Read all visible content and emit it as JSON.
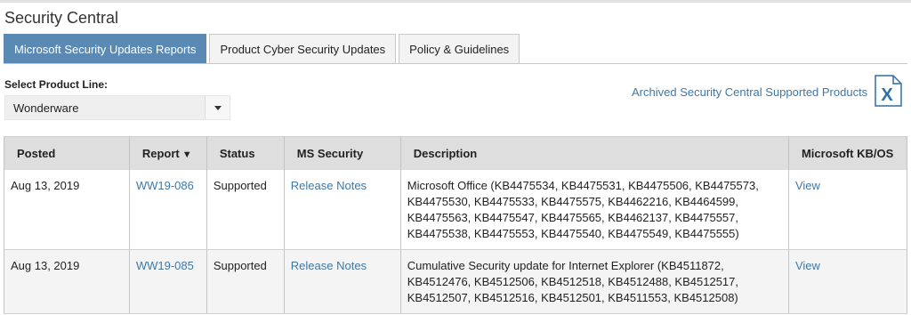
{
  "page": {
    "title": "Security Central"
  },
  "tabs": [
    {
      "label": "Microsoft Security Updates Reports",
      "active": true
    },
    {
      "label": "Product Cyber Security Updates",
      "active": false
    },
    {
      "label": "Policy & Guidelines",
      "active": false
    }
  ],
  "product_line": {
    "label": "Select Product Line:",
    "selected": "Wonderware"
  },
  "archived_link": "Archived Security Central Supported Products",
  "export_icon": {
    "icon": "excel-icon",
    "glyph": "X"
  },
  "table": {
    "headers": {
      "posted": "Posted",
      "report": "Report",
      "report_sort_icon": "chevron-down-icon",
      "status": "Status",
      "ms_security": "MS Security",
      "description": "Description",
      "kb_os": "Microsoft KB/OS"
    },
    "rows": [
      {
        "posted": "Aug 13, 2019",
        "report": "WW19-086",
        "status": "Supported",
        "ms_security": "Release Notes",
        "description": "Microsoft Office (KB4475534, KB4475531, KB4475506, KB4475573, KB4475530, KB4475533, KB4475575, KB4462216, KB4464599, KB4475563, KB4475547, KB4475565, KB4462137, KB4475557, KB4475538, KB4475553, KB4475540, KB4475549, KB4475555)",
        "kb_os": "View"
      },
      {
        "posted": "Aug 13, 2019",
        "report": "WW19-085",
        "status": "Supported",
        "ms_security": "Release Notes",
        "description": "Cumulative Security update for Internet Explorer (KB4511872, KB4512476, KB4512506, KB4512518, KB4512488, KB4512517, KB4512507, KB4512516, KB4512501, KB4511553, KB4512508)",
        "kb_os": "View"
      }
    ]
  },
  "colors": {
    "accent": "#5a8ab3",
    "link": "#3d79a8",
    "header_bg": "#dedede",
    "excel_blue": "#2f6fa6"
  }
}
